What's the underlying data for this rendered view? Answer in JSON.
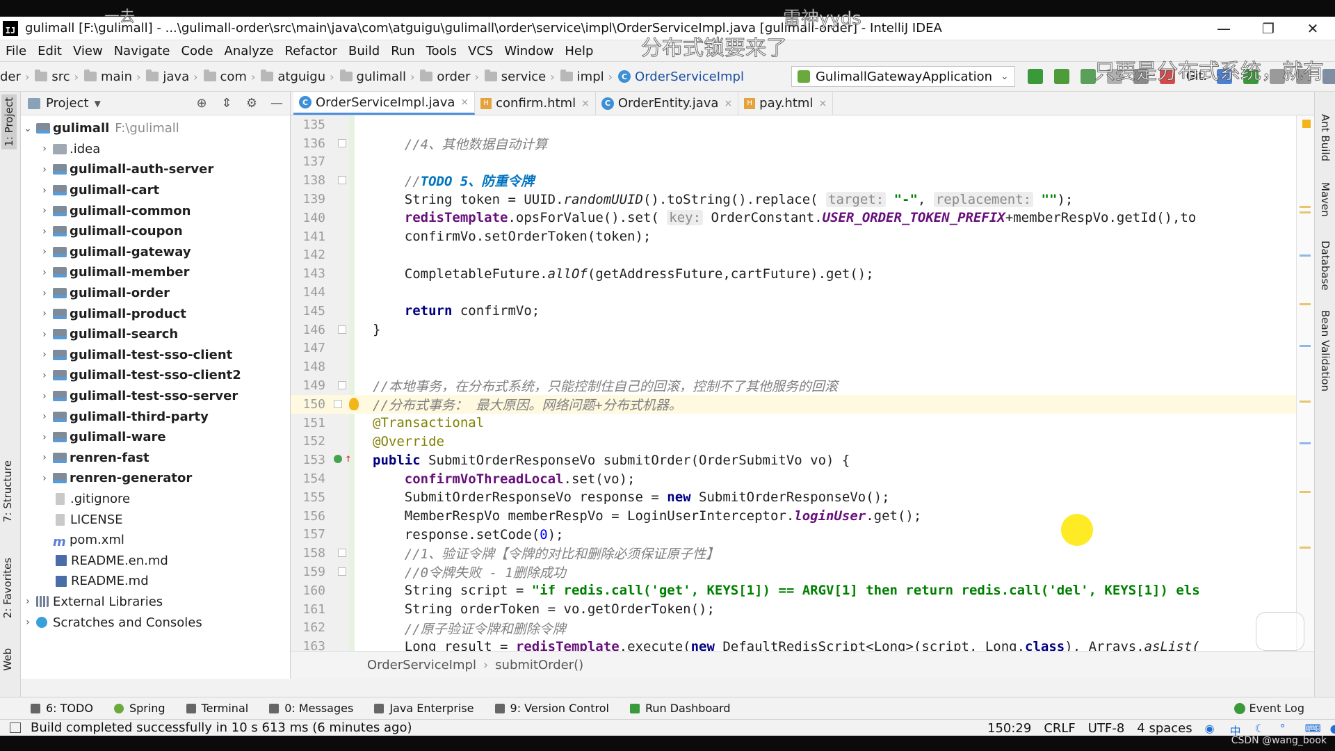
{
  "window": {
    "title": "gulimall [F:\\gulimall] - ...\\gulimall-order\\src\\main\\java\\com\\atguigu\\gulimall\\order\\service\\impl\\OrderServiceImpl.java [gulimall-order] - IntelliJ IDEA",
    "logo_text": "IJ",
    "minimize": "—",
    "restore": "❐",
    "close": "✕"
  },
  "menu": [
    "File",
    "Edit",
    "View",
    "Navigate",
    "Code",
    "Analyze",
    "Refactor",
    "Build",
    "Run",
    "Tools",
    "VCS",
    "Window",
    "Help"
  ],
  "navbar": {
    "crumbs": [
      "der",
      "src",
      "main",
      "java",
      "com",
      "atguigu",
      "gulimall",
      "order",
      "service",
      "impl"
    ],
    "active_class": "OrderServiceImpl",
    "run_config": "GulimallGatewayApplication",
    "vcs_label": "Git:"
  },
  "project_panel": {
    "title": "Project",
    "root": {
      "name": "gulimall",
      "path": "F:\\gulimall"
    },
    "items": [
      {
        "name": ".idea",
        "type": "folder",
        "bold": false
      },
      {
        "name": "gulimall-auth-server",
        "type": "module",
        "bold": true
      },
      {
        "name": "gulimall-cart",
        "type": "module",
        "bold": true
      },
      {
        "name": "gulimall-common",
        "type": "module",
        "bold": true
      },
      {
        "name": "gulimall-coupon",
        "type": "module",
        "bold": true
      },
      {
        "name": "gulimall-gateway",
        "type": "module",
        "bold": true
      },
      {
        "name": "gulimall-member",
        "type": "module",
        "bold": true
      },
      {
        "name": "gulimall-order",
        "type": "module",
        "bold": true
      },
      {
        "name": "gulimall-product",
        "type": "module",
        "bold": true
      },
      {
        "name": "gulimall-search",
        "type": "module",
        "bold": true
      },
      {
        "name": "gulimall-test-sso-client",
        "type": "module",
        "bold": true
      },
      {
        "name": "gulimall-test-sso-client2",
        "type": "module",
        "bold": true
      },
      {
        "name": "gulimall-test-sso-server",
        "type": "module",
        "bold": true
      },
      {
        "name": "gulimall-third-party",
        "type": "module",
        "bold": true
      },
      {
        "name": "gulimall-ware",
        "type": "module",
        "bold": true
      },
      {
        "name": "renren-fast",
        "type": "module",
        "bold": true
      },
      {
        "name": "renren-generator",
        "type": "module",
        "bold": true
      },
      {
        "name": ".gitignore",
        "type": "file",
        "bold": false
      },
      {
        "name": "LICENSE",
        "type": "file",
        "bold": false
      },
      {
        "name": "pom.xml",
        "type": "maven",
        "bold": false
      },
      {
        "name": "README.en.md",
        "type": "md",
        "bold": false
      },
      {
        "name": "README.md",
        "type": "md",
        "bold": false
      }
    ],
    "external_libraries": "External Libraries",
    "scratches": "Scratches and Consoles"
  },
  "left_strip": {
    "project": "1: Project",
    "structure": "7: Structure",
    "favorites": "2: Favorites",
    "web": "Web"
  },
  "right_strip": {
    "ant": "Ant Build",
    "maven": "Maven",
    "database": "Database",
    "bean": "Bean Validation"
  },
  "tabs": [
    {
      "label": "OrderServiceImpl.java",
      "icon": "class-icon",
      "active": true
    },
    {
      "label": "confirm.html",
      "icon": "html-icon",
      "active": false
    },
    {
      "label": "OrderEntity.java",
      "icon": "class-icon",
      "active": false
    },
    {
      "label": "pay.html",
      "icon": "html-icon",
      "active": false
    }
  ],
  "tab_close": "×",
  "code": {
    "l135": "135",
    "l136": "136",
    "l137": "137",
    "l138": "138",
    "l139": "139",
    "l140": "140",
    "l141": "141",
    "l142": "142",
    "l143": "143",
    "l144": "144",
    "l145": "145",
    "l146": "146",
    "l147": "147",
    "l148": "148",
    "l149": "149",
    "l150": "150",
    "l151": "151",
    "l152": "152",
    "l153": "153",
    "l154": "154",
    "l155": "155",
    "l156": "156",
    "l157": "157",
    "l158": "158",
    "l159": "159",
    "l160": "160",
    "l161": "161",
    "l162": "162",
    "l163": "163",
    "c136": "//4、其他数据自动计算",
    "c138_a": "//",
    "c138_todo": "TODO 5、防重令牌",
    "c139_a": "String token = UUID.",
    "c139_b": "randomUUID",
    "c139_c": "().toString().replace(",
    "c139_h1": "target:",
    "c139_s1": "\"-\"",
    "c139_d": ", ",
    "c139_h2": "replacement:",
    "c139_s2": "\"\"",
    "c139_e": ");",
    "c140_a": "redisTemplate",
    "c140_b": ".opsForValue().set(",
    "c140_h": "key:",
    "c140_c": " OrderConstant.",
    "c140_d": "USER_ORDER_TOKEN_PREFIX",
    "c140_e": "+memberRespVo.getId(),to",
    "c141": "confirmVo.setOrderToken(token);",
    "c143_a": "CompletableFuture.",
    "c143_b": "allOf",
    "c143_c": "(getAddressFuture,cartFuture).get();",
    "c145_kw": "return",
    "c145_b": " confirmVo;",
    "c146": "}",
    "c149": "//本地事务，在分布式系统，只能控制住自己的回滚，控制不了其他服务的回滚",
    "c150": "//分布式事务： 最大原因。网络问题+分布式机器。",
    "c151": "@Transactional",
    "c152": "@Override",
    "c153_kw": "public",
    "c153_b": " SubmitOrderResponseVo submitOrder(OrderSubmitVo vo) {",
    "c154_a": "confirmVoThreadLocal",
    "c154_b": ".set(vo);",
    "c155_a": "SubmitOrderResponseVo response = ",
    "c155_kw": "new",
    "c155_b": " SubmitOrderResponseVo();",
    "c156_a": "MemberRespVo memberRespVo = LoginUserInterceptor.",
    "c156_b": "loginUser",
    "c156_c": ".get();",
    "c157_a": "response.setCode(",
    "c157_n": "0",
    "c157_b": ");",
    "c158": "//1、验证令牌【令牌的对比和删除必须保证原子性】",
    "c159": "//0令牌失败 - 1删除成功",
    "c160_a": "String script = ",
    "c160_s": "\"if redis.call('get', KEYS[1]) == ARGV[1] then return redis.call('del', KEYS[1]) els",
    "c161": "String orderToken = vo.getOrderToken();",
    "c162": "//原子验证令牌和删除令牌",
    "c163_a": "Long result = ",
    "c163_b": "redisTemplate",
    "c163_c": ".execute(",
    "c163_kw": "new",
    "c163_d": " DefaultRedisScript<Long>(script, Long.",
    "c163_kw2": "class",
    "c163_e": "), Arrays.",
    "c163_f": "asList("
  },
  "editor_breadcrumb": {
    "cls": "OrderServiceImpl",
    "method": "submitOrder()"
  },
  "bottom_tools": [
    {
      "label": "6: TODO"
    },
    {
      "label": "Spring"
    },
    {
      "label": "Terminal"
    },
    {
      "label": "0: Messages"
    },
    {
      "label": "Java Enterprise"
    },
    {
      "label": "9: Version Control"
    },
    {
      "label": "Run Dashboard"
    }
  ],
  "event_log": "Event Log",
  "status": {
    "message": "Build completed successfully in 10 s 613 ms (6 minutes ago)",
    "position": "150:29",
    "line_sep": "CRLF",
    "encoding": "UTF-8",
    "indent": "4 spaces"
  },
  "overlays": {
    "top_small": "一去",
    "top_channel": "雷神yyds",
    "subtitle": "分布式锁要来了",
    "scroll_note": "只要是分布式系统，就有",
    "credit": "CSDN @wang_book"
  },
  "colors": {
    "accent": "#4d8ee0",
    "keyword": "#000080",
    "comment": "#808080",
    "string": "#008000",
    "field": "#660e7a"
  }
}
